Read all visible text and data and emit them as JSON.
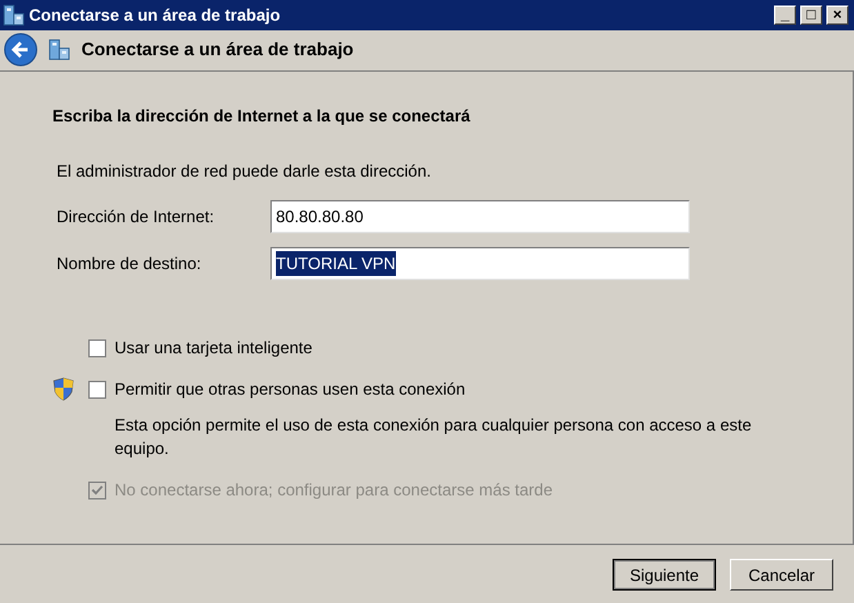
{
  "window": {
    "title": "Conectarse a un área de trabajo",
    "controls": [
      "_",
      "□",
      "×"
    ]
  },
  "header": {
    "title": "Conectarse a un área de trabajo"
  },
  "heading": "Escriba la dirección de Internet a la que se conectará",
  "intro": "El administrador de red puede darle esta dirección.",
  "fields": [
    {
      "label": "Dirección de Internet:",
      "value": "80.80.80.80",
      "selected": false
    },
    {
      "label": "Nombre de destino:",
      "value": "TUTORIAL VPN",
      "selected": true
    }
  ],
  "options": [
    {
      "label": "Usar una tarjeta inteligente",
      "checked": false,
      "disabled": false,
      "shield": false
    },
    {
      "label": "Permitir que otras personas usen esta conexión",
      "checked": false,
      "disabled": false,
      "shield": true,
      "description": "Esta opción permite el uso de esta conexión para cualquier persona con acceso a este equipo."
    },
    {
      "label": "No conectarse ahora; configurar para conectarse más tarde",
      "checked": true,
      "disabled": true,
      "shield": false
    }
  ],
  "buttons": [
    {
      "label": "Siguiente",
      "default": true
    },
    {
      "label": "Cancelar",
      "default": false
    }
  ]
}
